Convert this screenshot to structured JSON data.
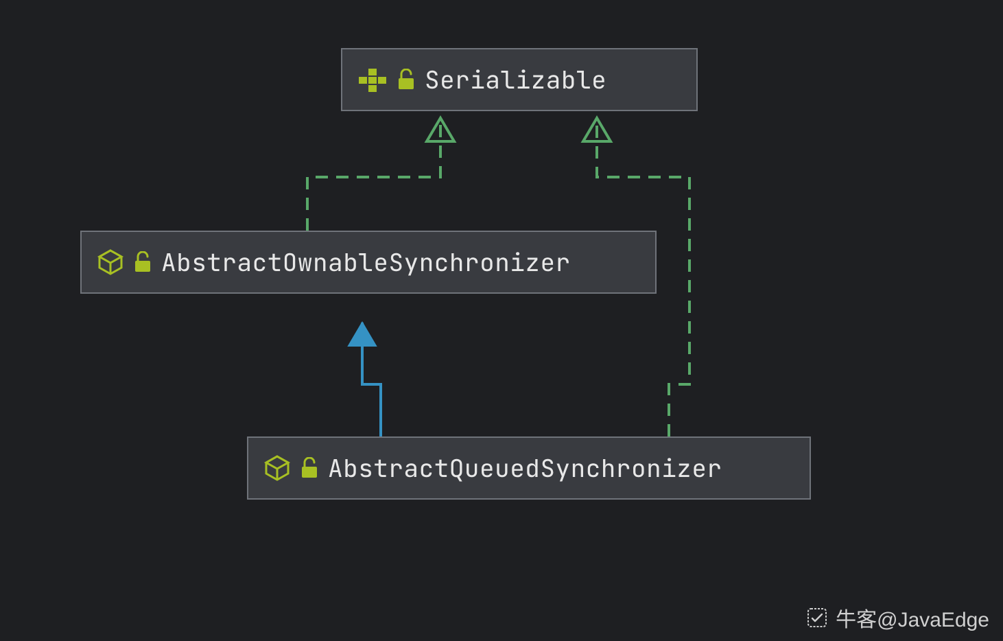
{
  "diagram": {
    "nodes": {
      "serializable": {
        "label": "Serializable",
        "kind": "interface"
      },
      "abstractOwnableSynchronizer": {
        "label": "AbstractOwnableSynchronizer",
        "kind": "abstract-class"
      },
      "abstractQueuedSynchronizer": {
        "label": "AbstractQueuedSynchronizer",
        "kind": "abstract-class"
      }
    },
    "edges": [
      {
        "from": "abstractOwnableSynchronizer",
        "to": "serializable",
        "relation": "implements"
      },
      {
        "from": "abstractQueuedSynchronizer",
        "to": "serializable",
        "relation": "implements"
      },
      {
        "from": "abstractQueuedSynchronizer",
        "to": "abstractOwnableSynchronizer",
        "relation": "extends"
      }
    ],
    "colors": {
      "implements": "#59a869",
      "extends": "#3592c4",
      "nodeBg": "#393b40",
      "nodeBorder": "#6f737a",
      "iconGreen": "#a8c023",
      "text": "#e8e8e8",
      "canvasBg": "#1e1f22"
    }
  },
  "watermark": {
    "text": "牛客@JavaEdge"
  }
}
